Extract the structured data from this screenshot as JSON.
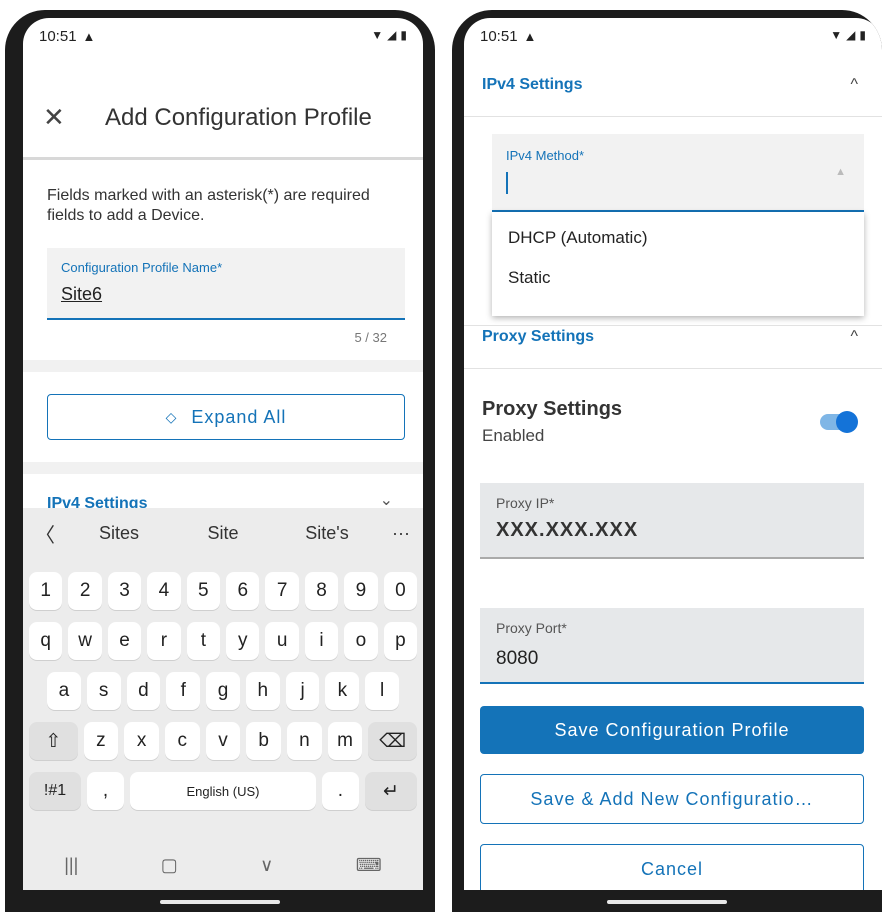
{
  "left": {
    "status": {
      "time": "10:51",
      "warn": "▲"
    },
    "header": {
      "title": "Add Configuration Profile",
      "close": "✕"
    },
    "description": "Fields marked with an asterisk(*) are required fields to add a Device.",
    "name_field": {
      "label": "Configuration Profile Name*",
      "value": "Site6",
      "counter": "5 / 32"
    },
    "expand_all": {
      "icon": "◇",
      "label": "Expand All"
    },
    "ipv4_section": {
      "title": "IPv4 Settings",
      "chevron": "⌄"
    },
    "keyboard": {
      "suggestions": [
        "Sites",
        "Site",
        "Site's"
      ],
      "back": "〈",
      "more": "···",
      "row_numbers": [
        "1",
        "2",
        "3",
        "4",
        "5",
        "6",
        "7",
        "8",
        "9",
        "0"
      ],
      "row_q": [
        "q",
        "w",
        "e",
        "r",
        "t",
        "y",
        "u",
        "i",
        "o",
        "p"
      ],
      "row_a": [
        "a",
        "s",
        "d",
        "f",
        "g",
        "h",
        "j",
        "k",
        "l"
      ],
      "row_z": [
        "z",
        "x",
        "c",
        "v",
        "b",
        "n",
        "m"
      ],
      "shift": "⇧",
      "backspace": "⌫",
      "symbols": "!#1",
      "comma": ",",
      "space": "English (US)",
      "period": ".",
      "enter": "↵",
      "nav_recents": "|||",
      "nav_home": "▢",
      "nav_back": "∨",
      "nav_keyboard": "⌨"
    }
  },
  "right": {
    "status": {
      "time": "10:51",
      "warn": "▲"
    },
    "ipv4_section": {
      "title": "IPv4 Settings",
      "chevron": "^"
    },
    "ipv4_method": {
      "label": "IPv4 Method*",
      "arrow": "▲"
    },
    "dropdown_options": [
      "DHCP (Automatic)",
      "Static"
    ],
    "proxy_section": {
      "title": "Proxy Settings",
      "chevron": "^"
    },
    "proxy_toggle": {
      "title": "Proxy Settings",
      "state": "Enabled"
    },
    "proxy_ip": {
      "label": "Proxy IP*",
      "value": "XXX.XXX.XXX"
    },
    "proxy_port": {
      "label": "Proxy Port*",
      "value": "8080"
    },
    "buttons": {
      "save": "Save Configuration Profile",
      "save_add": "Save & Add New Configuratio…",
      "cancel": "Cancel"
    }
  },
  "colors": {
    "accent": "#1473b8",
    "toggle_on": "#1473d8"
  }
}
